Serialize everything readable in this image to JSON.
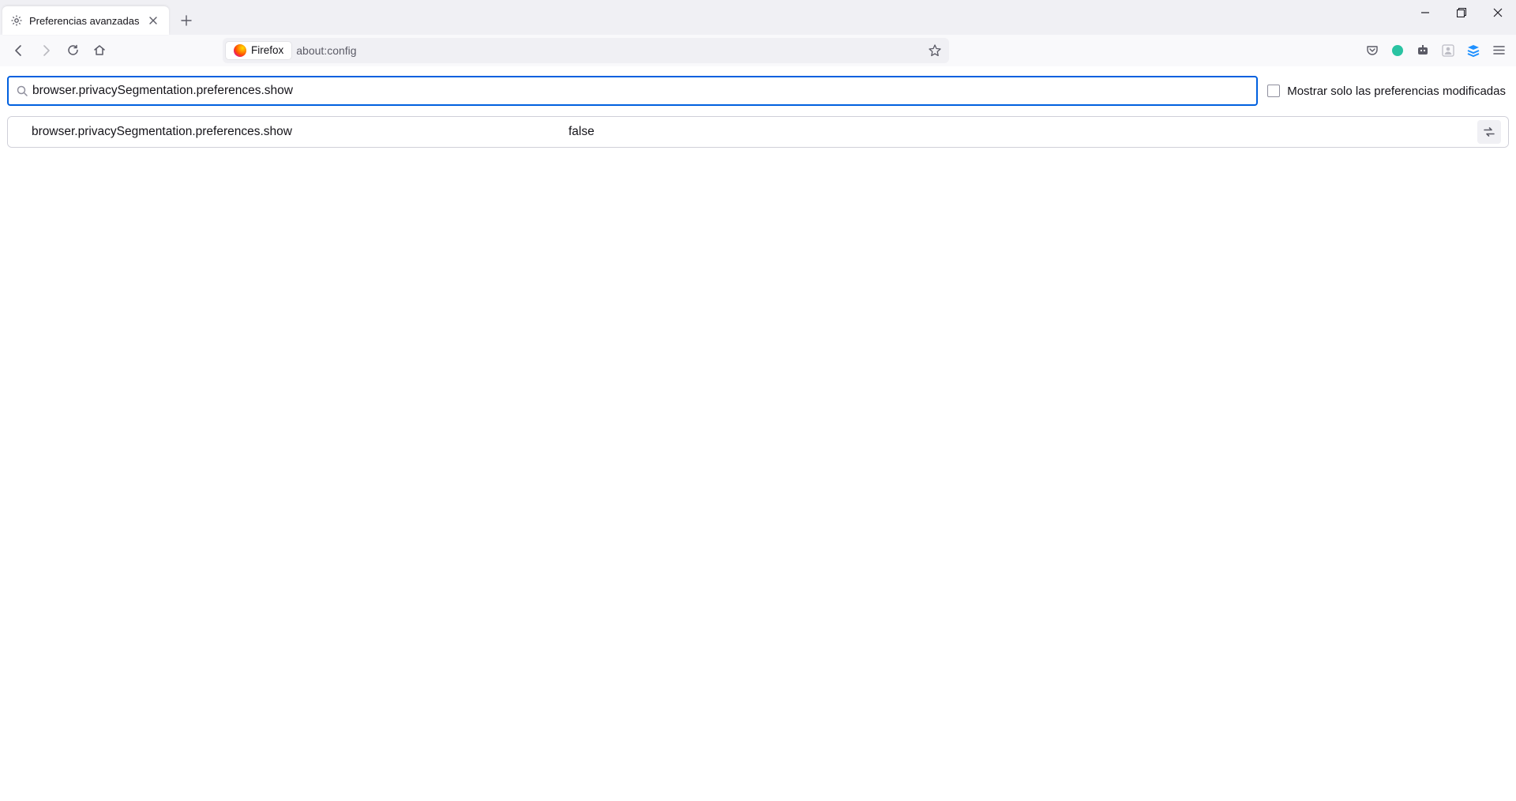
{
  "window": {
    "tab_title": "Preferencias avanzadas"
  },
  "urlbar": {
    "identity_label": "Firefox",
    "url": "about:config"
  },
  "config": {
    "search_value": "browser.privacySegmentation.preferences.show",
    "filter_label": "Mostrar solo las preferencias modificadas",
    "rows": [
      {
        "name": "browser.privacySegmentation.preferences.show",
        "value": "false"
      }
    ]
  }
}
